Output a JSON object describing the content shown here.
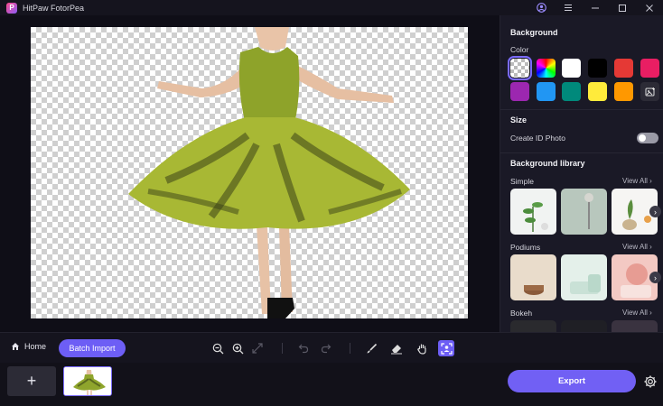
{
  "app": {
    "title": "HitPaw FotorPea",
    "logo_letter": "P"
  },
  "panel": {
    "background_title": "Background",
    "color_label": "Color",
    "colors": [
      "transparent",
      "rainbow",
      "#ffffff",
      "#000000",
      "#e53935",
      "#e91e63",
      "#9c27b0",
      "#2196f3",
      "#00897b",
      "#ffeb3b",
      "#ff9800",
      "upload-image"
    ],
    "size_title": "Size",
    "id_photo_label": "Create ID Photo",
    "library_title": "Background library",
    "categories": [
      {
        "name": "Simple",
        "view_all": "View All"
      },
      {
        "name": "Podiums",
        "view_all": "View All"
      },
      {
        "name": "Bokeh",
        "view_all": "View All"
      }
    ]
  },
  "toolbar": {
    "home_label": "Home",
    "batch_label": "Batch Import",
    "tools": [
      "zoom-out-icon",
      "zoom-in-icon",
      "fit-screen-icon",
      "undo-icon",
      "redo-icon",
      "brush-icon",
      "eraser-icon",
      "hand-icon",
      "portrait-select-icon"
    ]
  },
  "strip": {
    "add_label": "+",
    "export_label": "Export"
  },
  "accent": "#6d5ef5"
}
